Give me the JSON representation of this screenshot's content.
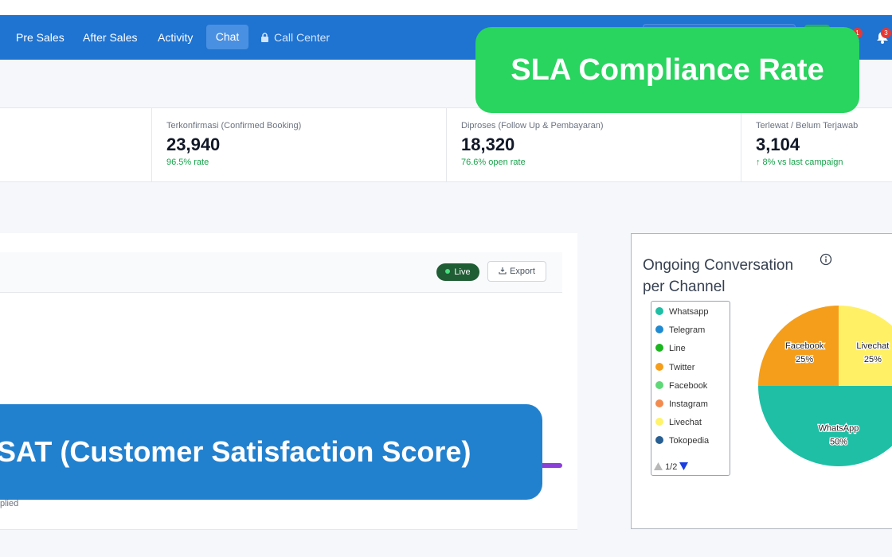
{
  "nav": {
    "items": [
      "Pre Sales",
      "After Sales",
      "Activity"
    ],
    "active": "Chat",
    "call_center": "Call Center",
    "badges": [
      "1",
      "3"
    ]
  },
  "stats": [
    {
      "label": "Terkonfirmasi (Confirmed Booking)",
      "value": "23,940",
      "sub": "96.5% rate"
    },
    {
      "label": "Diproses (Follow Up & Pembayaran)",
      "value": "18,320",
      "sub": "76.6% open rate"
    },
    {
      "label": "Terlewat / Belum Terjawab",
      "value": "3,104",
      "sub": "↑ 8% vs last campaign"
    }
  ],
  "main_card": {
    "live": "Live",
    "export": "Export",
    "replied_fragment": "plied"
  },
  "banners": {
    "sla": "SLA Compliance Rate",
    "csat": "CSAT (Customer Satisfaction Score)"
  },
  "conversation_card": {
    "title": "Ongoing Conversation per Channel",
    "legend": [
      {
        "label": "Whatsapp",
        "color": "#1fbfa6"
      },
      {
        "label": "Telegram",
        "color": "#1f8ad1"
      },
      {
        "label": "Line",
        "color": "#1bb520"
      },
      {
        "label": "Twitter",
        "color": "#f59e1b"
      },
      {
        "label": "Facebook",
        "color": "#5fd878"
      },
      {
        "label": "Instagram",
        "color": "#f38b4f"
      },
      {
        "label": "Livechat",
        "color": "#fff36b"
      },
      {
        "label": "Tokopedia",
        "color": "#275f92"
      }
    ],
    "pager": "1/2"
  },
  "chart_data": {
    "type": "pie",
    "slices": [
      {
        "label": "Livechat",
        "percent_label": "25%",
        "value": 25,
        "color": "#fff066"
      },
      {
        "label": "WhatsApp",
        "percent_label": "50%",
        "value": 50,
        "color": "#1fbfa6"
      },
      {
        "label": "Facebook",
        "percent_label": "25%",
        "value": 25,
        "color": "#f59e1b"
      }
    ]
  }
}
